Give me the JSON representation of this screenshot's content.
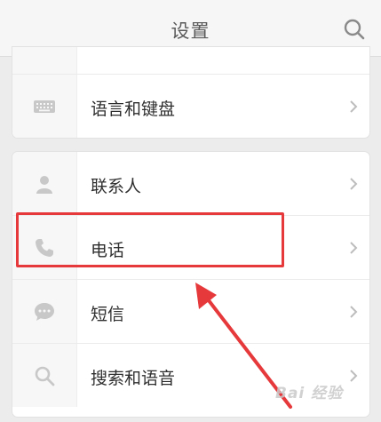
{
  "header": {
    "title": "设置",
    "search_icon": "search-icon"
  },
  "card1": {
    "rows": [
      {
        "label": "",
        "icon": ""
      },
      {
        "label": "语言和键盘",
        "icon": "keyboard-icon"
      }
    ]
  },
  "card2": {
    "rows": [
      {
        "label": "联系人",
        "icon": "contact-person-icon"
      },
      {
        "label": "电话",
        "icon": "phone-icon"
      },
      {
        "label": "短信",
        "icon": "sms-bubble-icon"
      },
      {
        "label": "搜索和语音",
        "icon": "search-icon"
      }
    ]
  },
  "annotation": {
    "highlighted_item": "电话",
    "color": "#e5393c"
  },
  "watermark": {
    "text": "Bai 经验"
  },
  "colors": {
    "icon_gray": "#c8c8c8",
    "chevron": "#bdbdbd",
    "text": "#2f2f2f"
  }
}
